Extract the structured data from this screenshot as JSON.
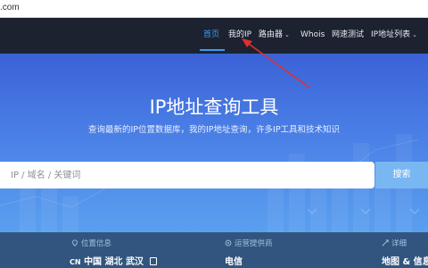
{
  "browser": {
    "url_fragment": ".com"
  },
  "nav": {
    "items": [
      {
        "label": "首页",
        "caret": false
      },
      {
        "label": "我的IP",
        "caret": false
      },
      {
        "label": "路由器",
        "caret": true
      },
      {
        "label": "Whois",
        "caret": false
      },
      {
        "label": "网速测试",
        "caret": false
      },
      {
        "label": "IP地址列表",
        "caret": true
      }
    ],
    "active_index": 0,
    "accent_color": "#3d9cf0"
  },
  "hero": {
    "title": "IP地址查询工具",
    "subtitle": "查询最新的IP位置数据库，我的IP地址查询，许多IP工具和技术知识",
    "search_placeholder": "IP / 域名 / 关键词",
    "search_button": "搜索"
  },
  "info": {
    "location": {
      "label": "位置信息",
      "country_code": "CN",
      "value": "中国 湖北 武汉"
    },
    "isp": {
      "label": "运营提供商",
      "value": "电信"
    },
    "detail": {
      "label": "详细",
      "value": "地图 & 信息"
    }
  },
  "annotation": {
    "color": "#e03030"
  }
}
